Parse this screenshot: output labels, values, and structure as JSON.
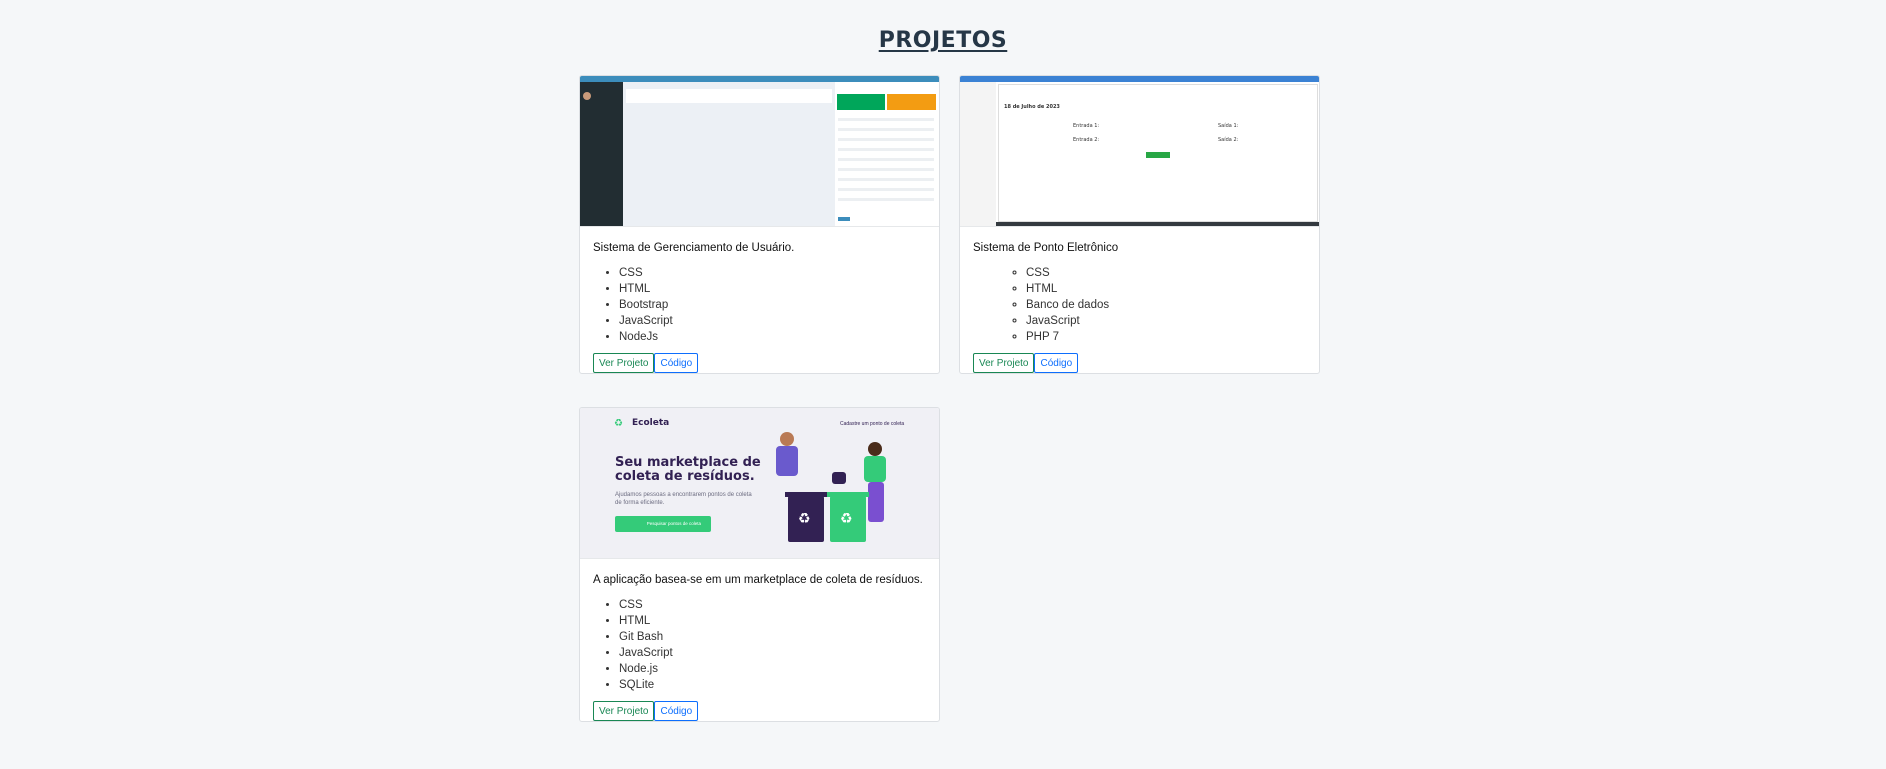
{
  "section": {
    "title": "PROJETOS"
  },
  "projects": [
    {
      "description": "Sistema de Gerenciamento de Usuário.",
      "techs": [
        "CSS",
        "HTML",
        "Bootstrap",
        "JavaScript",
        "NodeJs"
      ],
      "view_label": "Ver Projeto",
      "code_label": "Código"
    },
    {
      "description": "Sistema de Ponto Eletrônico",
      "techs": [
        "CSS",
        "HTML",
        "Banco de dados",
        "JavaScript",
        "PHP 7"
      ],
      "view_label": "Ver Projeto",
      "code_label": "Código",
      "thumb": {
        "date": "18 de Julho de 2023",
        "entrada1": "Entrada 1:",
        "saida1": "Saída 1:",
        "entrada2": "Entrada 2:",
        "saida2": "Saída 2:"
      }
    },
    {
      "description": "A aplicação basea-se em um marketplace de coleta de resíduos.",
      "techs": [
        "CSS",
        "HTML",
        "Git Bash",
        "JavaScript",
        "Node.js",
        "SQLite"
      ],
      "view_label": "Ver Projeto",
      "code_label": "Código",
      "thumb": {
        "logo": "Ecoleta",
        "link": "Cadastre um ponto de coleta",
        "headline": "Seu marketplace de coleta de resíduos.",
        "text": "Ajudamos pessoas a encontrarem pontos de coleta de forma eficiente.",
        "cta": "Pesquisar pontos de coleta"
      }
    }
  ]
}
